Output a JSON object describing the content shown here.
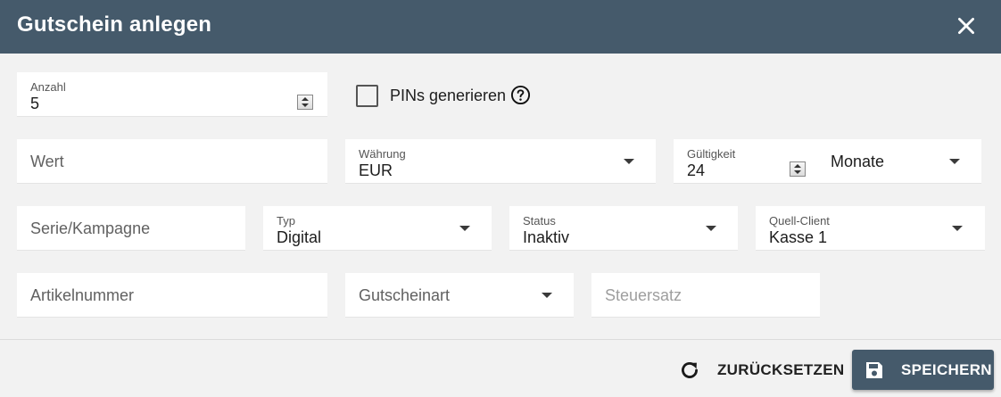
{
  "dialog": {
    "title": "Gutschein anlegen"
  },
  "fields": {
    "anzahl": {
      "label": "Anzahl",
      "value": "5"
    },
    "pins": {
      "label": "PINs generieren",
      "checked": false
    },
    "wert": {
      "placeholder": "Wert"
    },
    "waehrung": {
      "label": "Währung",
      "value": "EUR"
    },
    "gueltigkeit": {
      "label": "Gültigkeit",
      "value": "24"
    },
    "gueltigkeit_einheit": {
      "value": "Monate"
    },
    "serie": {
      "placeholder": "Serie/Kampagne"
    },
    "typ": {
      "label": "Typ",
      "value": "Digital"
    },
    "status": {
      "label": "Status",
      "value": "Inaktiv"
    },
    "quell_client": {
      "label": "Quell-Client",
      "value": "Kasse 1"
    },
    "artikelnummer": {
      "placeholder": "Artikelnummer"
    },
    "gutscheinart": {
      "placeholder": "Gutscheinart"
    },
    "steuersatz": {
      "placeholder": "Steuersatz"
    }
  },
  "actions": {
    "reset_label": "ZURÜCKSETZEN",
    "save_label": "SPEICHERN"
  },
  "icons": {
    "close": "close-icon",
    "help": "help-circle-icon",
    "reset": "refresh-icon",
    "save": "save-icon"
  },
  "colors": {
    "primary": "#455a6b",
    "background": "#f2f2f2",
    "field": "#ffffff"
  }
}
